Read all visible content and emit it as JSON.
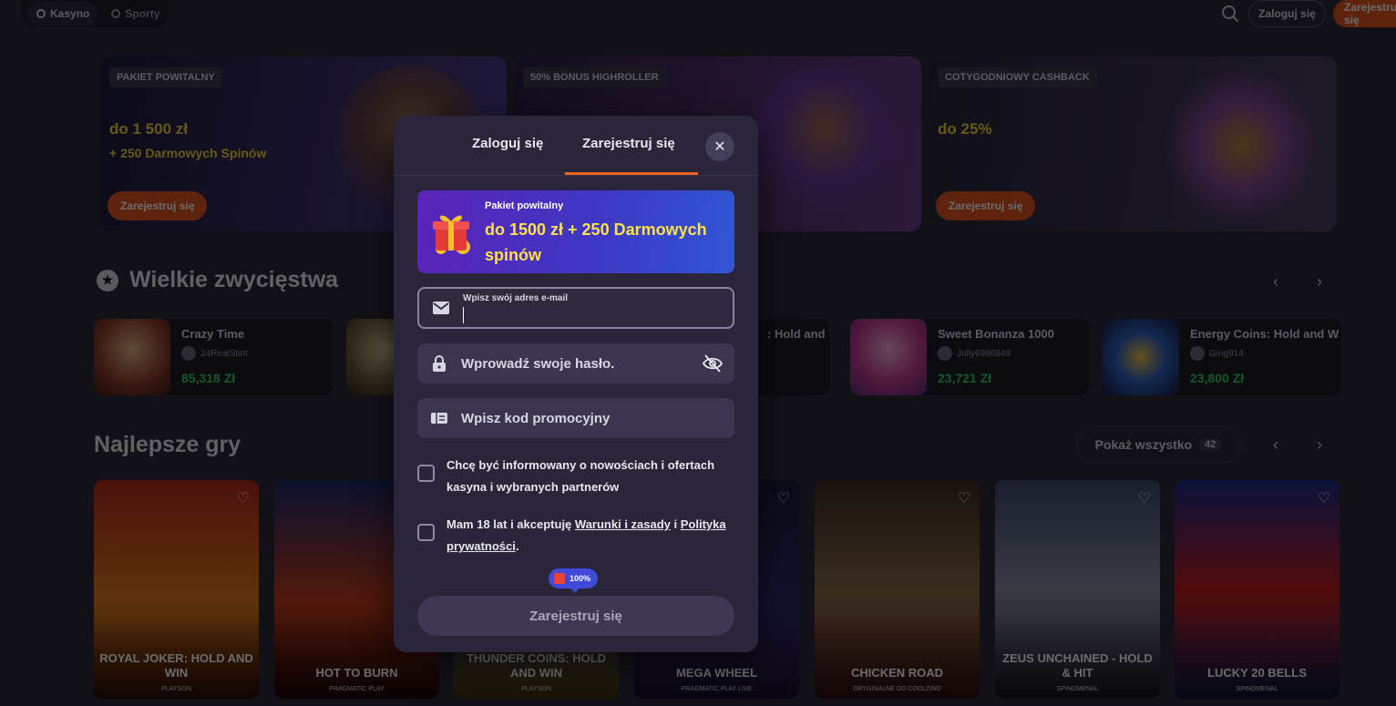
{
  "topbar": {
    "tab_casino": "Kasyno",
    "tab_sports": "Sporty",
    "login": "Zaloguj się",
    "register": "Zarejestruj się"
  },
  "promos": [
    {
      "tag": "PAKIET POWITALNY",
      "title": "do 1 500 zł",
      "sub": "+ 250 Darmowych Spinów",
      "button": "Zarejestruj się"
    },
    {
      "tag": "50% BONUS HIGHROLLER"
    },
    {
      "tag": "COTYGODNIOWY CASHBACK",
      "title": "do 25%",
      "button": "Zarejestruj się"
    }
  ],
  "big_wins": {
    "title": "Wielkie zwycięstwa",
    "items": [
      {
        "game": "Crazy Time",
        "user": "24RealStint",
        "amount": "85,318 Zł"
      },
      {
        "game": ": Hold and"
      },
      {
        "game": "Sweet Bonanza 1000",
        "user": "Jolly6996949",
        "amount": "23,721 Zł"
      },
      {
        "game": "Energy Coins: Hold and W",
        "user": "Ging914",
        "amount": "23,800 Zł"
      }
    ]
  },
  "best_games": {
    "title": "Najlepsze gry",
    "show_all": "Pokaż wszystko",
    "count": "42",
    "items": [
      {
        "name": "ROYAL JOKER: HOLD AND WIN",
        "provider": "PLAYSON"
      },
      {
        "name": "HOT TO BURN",
        "provider": "PRAGMATIC PLAY"
      },
      {
        "name": "THUNDER COINS: HOLD AND WIN",
        "provider": "PLAYSON"
      },
      {
        "name": "MEGA WHEEL",
        "provider": "PRAGMATIC PLAY LIVE"
      },
      {
        "name": "CHICKEN ROAD",
        "provider": "ORYGINALNE OD COOLZINO"
      },
      {
        "name": "ZEUS UNCHAINED - HOLD & HIT",
        "provider": "SPINOMENAL"
      },
      {
        "name": "LUCKY 20 BELLS",
        "provider": "SPINOMENAL"
      }
    ]
  },
  "modal": {
    "tab_login": "Zaloguj się",
    "tab_register": "Zarejestruj się",
    "bonus_label": "Pakiet powitalny",
    "bonus_text": "do 1500 zł + 250 Darmowych spinów",
    "email_label": "Wpisz swój adres e-mail",
    "email_value": "",
    "password_placeholder": "Wprowadź swoje hasło.",
    "promo_placeholder": "Wpisz kod promocyjny",
    "consent_news": "Chcę być informowany o nowościach i ofertach kasyna i wybranych partnerów",
    "consent_age_prefix": "Mam 18 lat i akceptuję ",
    "consent_terms_link": "Warunki i zasady",
    "consent_and": " i ",
    "consent_privacy_link": "Polityka prywatności",
    "consent_end": ".",
    "progress_badge": "100%",
    "submit": "Zarejestruj się"
  },
  "colors": {
    "accent_orange": "#f0641f",
    "bonus_yellow": "#fde14a",
    "win_green": "#32d05a",
    "modal_bg": "#2a2538"
  }
}
